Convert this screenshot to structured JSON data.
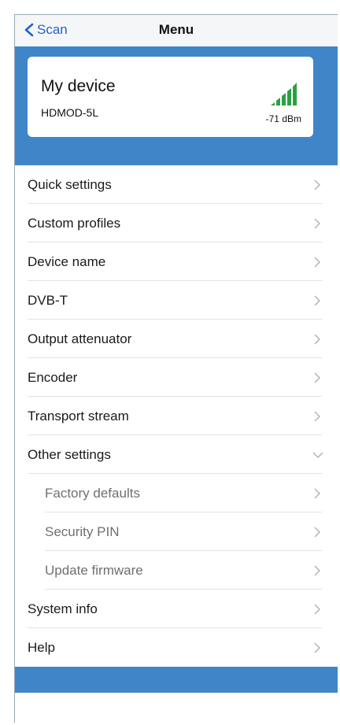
{
  "header": {
    "back_label": "Scan",
    "title": "Menu"
  },
  "device": {
    "name": "My device",
    "model": "HDMOD-5L",
    "signal": "-71 dBm",
    "signal_bars_filled": 5,
    "signal_bars_total": 5,
    "signal_color": "#2aa043"
  },
  "menu": {
    "items": [
      {
        "label": "Quick settings"
      },
      {
        "label": "Custom profiles"
      },
      {
        "label": "Device name"
      },
      {
        "label": "DVB-T"
      },
      {
        "label": "Output attenuator"
      },
      {
        "label": "Encoder"
      },
      {
        "label": "Transport stream"
      },
      {
        "label": "Other settings",
        "expanded": true
      },
      {
        "label": "Factory defaults",
        "sub": true
      },
      {
        "label": "Security PIN",
        "sub": true
      },
      {
        "label": "Update firmware",
        "sub": true
      },
      {
        "label": "System info"
      },
      {
        "label": "Help"
      }
    ]
  },
  "colors": {
    "accent": "#3f86c9",
    "link": "#1e64c8"
  }
}
